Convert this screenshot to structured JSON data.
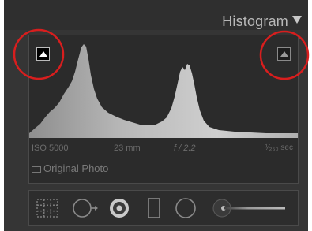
{
  "panel": {
    "title": "Histogram",
    "collapse_icon": "triangle-down-icon"
  },
  "histogram": {
    "shadow_clipping_icon": "triangle-up-icon",
    "highlight_clipping_icon": "triangle-up-icon",
    "info": {
      "iso": "ISO 5000",
      "focal_length": "23 mm",
      "aperture": "f / 2.2",
      "shutter": "¹⁄₂₅₀ sec"
    },
    "original_photo_label": "Original Photo"
  },
  "toolbar": {
    "tools": [
      {
        "name": "crop-overlay-icon"
      },
      {
        "name": "spot-removal-icon"
      },
      {
        "name": "red-eye-icon"
      },
      {
        "name": "graduated-filter-icon"
      },
      {
        "name": "radial-filter-icon"
      },
      {
        "name": "adjustment-brush-icon"
      }
    ]
  },
  "colors": {
    "panel_bg": "#353535",
    "histogram_fill": "#c9c9c9",
    "annotation_circle": "#d81e1e"
  }
}
